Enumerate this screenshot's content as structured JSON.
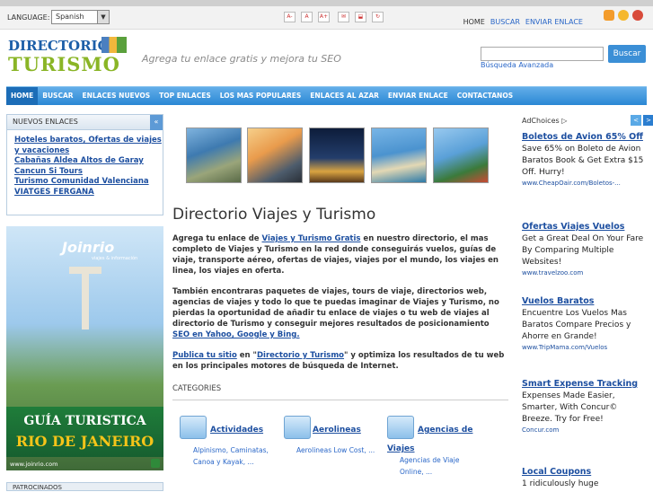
{
  "toolbar": {
    "language_label": "LANGUAGE:",
    "language_value": "Spanish",
    "tools": [
      "A-",
      "A",
      "A+",
      "✉",
      "⬓",
      "↻"
    ],
    "nav": [
      "HOME",
      "BUSCAR",
      "ENVIAR ENLACE"
    ]
  },
  "header": {
    "logo_line1": "DIRECTORIO",
    "logo_line2": "TURISMO",
    "tagline": "Agrega tu enlace gratis y mejora tu SEO",
    "search_button": "Buscar",
    "advanced_search": "Búsqueda Avanzada"
  },
  "mainnav": [
    "HOME",
    "BUSCAR",
    "ENLACES NUEVOS",
    "TOP ENLACES",
    "LOS MAS POPULARES",
    "ENLACES AL AZAR",
    "ENVIAR ENLACE",
    "CONTACTANOS"
  ],
  "left": {
    "box_title": "NUEVOS ENLACES",
    "toggle": "«",
    "links": [
      "Hoteles baratos, Ofertas de viajes",
      "y vacaciones",
      "Cabañas Aldea Altos de Garay",
      "Cancun Si Tours",
      "Turismo Comunidad Valenciana",
      "VIATGES FERGANA"
    ],
    "ad_logo": "Joinrio",
    "ad_logo_sub": "viajes & información",
    "ad_line1": "GUÍA TURISTICA",
    "ad_line2": "RIO DE JANEIRO",
    "ad_url": "www.joinrio.com",
    "box2_title": "PATROCINADOS"
  },
  "main": {
    "title": "Directorio Viajes y Turismo",
    "p1_a": "Agrega tu enlace de ",
    "p1_link": "Viajes y Turismo Gratis",
    "p1_b": " en nuestro directorio, el mas completo de Viajes y Turismo en la red donde conseguirás vuelos, guías de viaje, transporte aéreo, ofertas de viajes, viajes por el mundo, los viajes en linea, los viajes en oferta.",
    "p2_a": "También encontraras paquetes de viajes, tours de viaje, directorios web, agencias de viajes y todo lo que te puedas imaginar de Viajes  y Turismo, no pierdas la oportunidad de añadir tu enlace  de viajes o tu web de viajes al directorio de Turismo y conseguir mejores resultados de posicionamiento ",
    "p2_link": "SEO en Yahoo, Google y Bing.",
    "p3_link1": "Publica tu sitio",
    "p3_a": " en \"",
    "p3_link2": "Directorio y Turismo",
    "p3_b": "\" y optimiza los resultados de tu web en los principales motores de búsqueda de Internet.",
    "categories_label": "CATEGORIES",
    "categories": [
      {
        "title": "Actividades",
        "sub1": "Alpinismo, Caminatas,",
        "sub2": "Canoa y Kayak, ..."
      },
      {
        "title": "Aerolineas",
        "sub1": "Aerolineas Low Cost, ...",
        "sub2": ""
      },
      {
        "title": "Agencias de",
        "title2": "Viajes",
        "sub1": "Agencias de Viaje",
        "sub2": "Online, ..."
      }
    ]
  },
  "ads": {
    "adchoices": "AdChoices ▷",
    "prev": "<",
    "next": ">",
    "items": [
      {
        "title": "Boletos de Avion 65% Off",
        "desc": "Save 65% on Boleto de Avion Baratos Book & Get Extra $15 Off. Hurry!",
        "url": "www.CheapOair.com/Boletos-..."
      },
      {
        "title": "Ofertas Viajes Vuelos",
        "desc": "Get a Great Deal On Your Fare By Comparing Multiple Websites!",
        "url": "www.travelzoo.com"
      },
      {
        "title": "Vuelos Baratos",
        "desc": "Encuentre Los Vuelos Mas Baratos Compare Precios y Ahorre en Grande!",
        "url": "www.TripMama.com/Vuelos"
      },
      {
        "title": "Smart Expense Tracking",
        "desc": "Expenses Made Easier, Smarter, With Concur© Breeze. Try for Free!",
        "url": "Concur.com"
      },
      {
        "title": "Local Coupons",
        "desc": "1 ridiculously huge",
        "url": ""
      }
    ]
  },
  "colors": {
    "accent": "#2a87d4",
    "link": "#1d4fa0",
    "logo_green": "#8ab526"
  }
}
